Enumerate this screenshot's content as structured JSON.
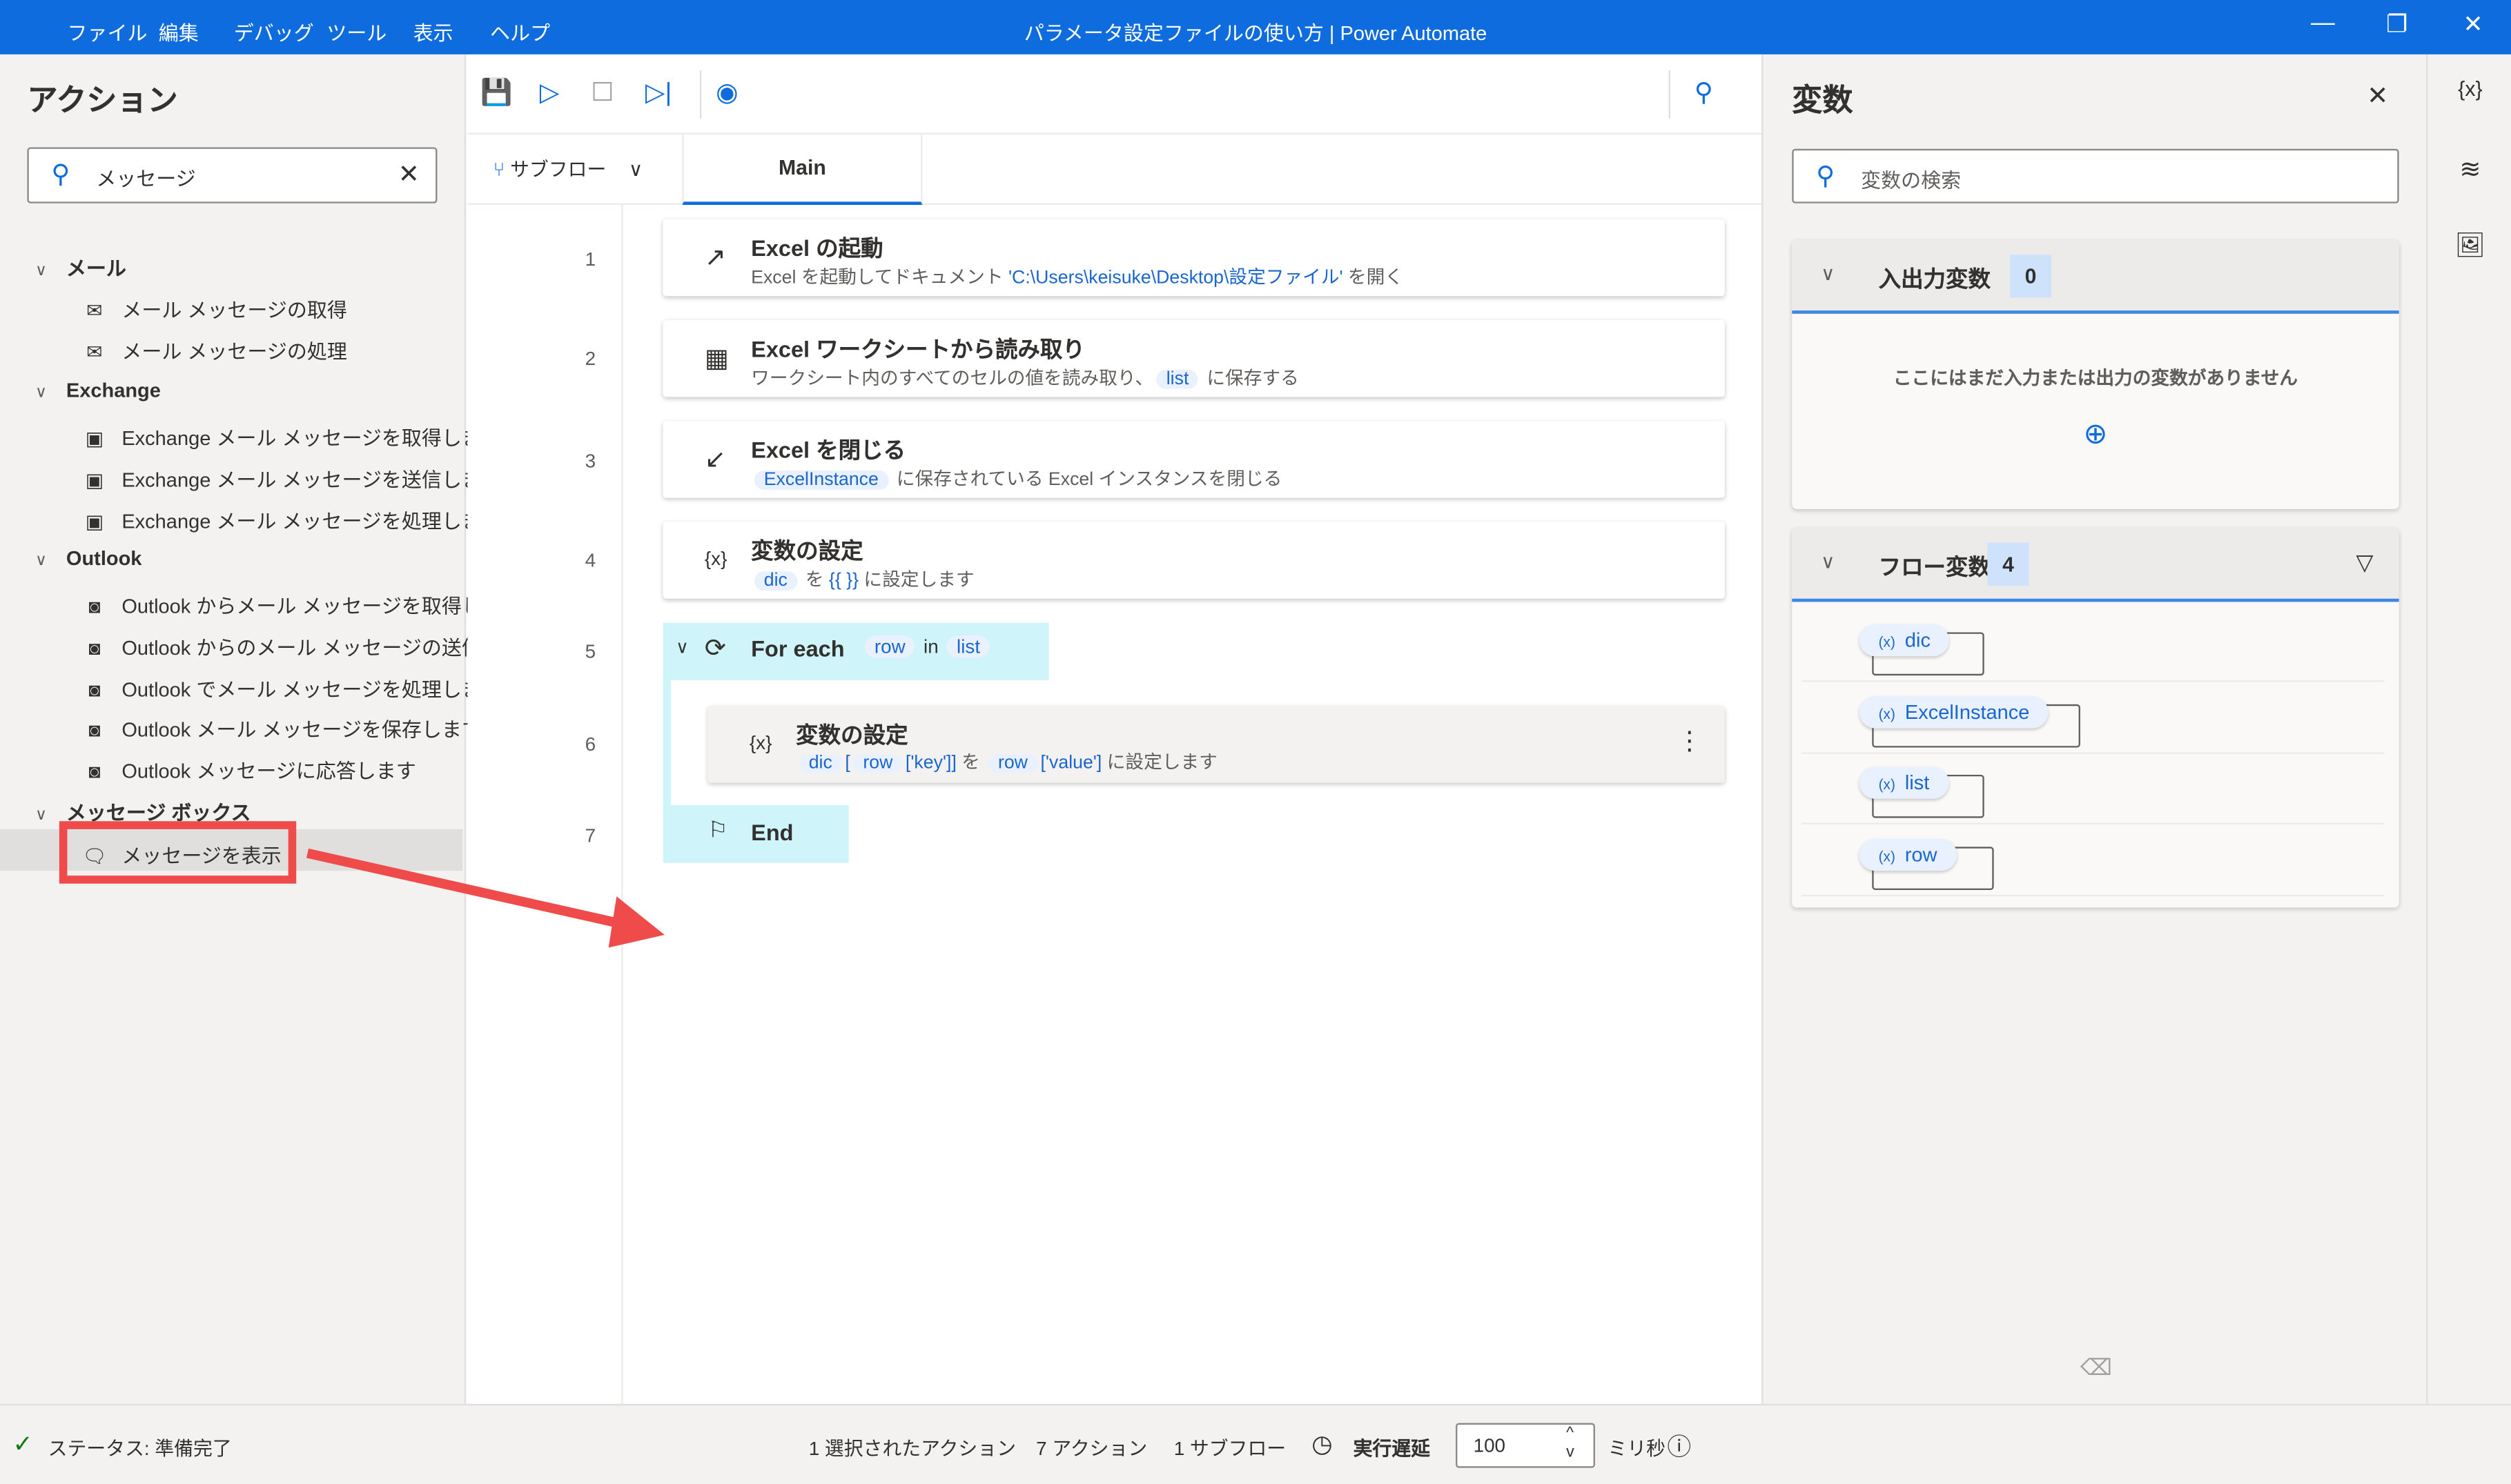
{
  "window": {
    "title": "パラメータ設定ファイルの使い方 | Power Automate",
    "menu": [
      "ファイル",
      "編集",
      "デバッグ",
      "ツール",
      "表示",
      "ヘルプ"
    ],
    "controls": [
      "—",
      "❐",
      "✕"
    ],
    "accent": "#0f6cde"
  },
  "actions_panel": {
    "title": "アクション",
    "search_value": "メッセージ",
    "groups": [
      {
        "label": "メール",
        "items": [
          "メール メッセージの取得",
          "メール メッセージの処理"
        ],
        "icon": "mail-icon"
      },
      {
        "label": "Exchange",
        "items": [
          "Exchange メール メッセージを取得します",
          "Exchange メール メッセージを送信します",
          "Exchange メール メッセージを処理します"
        ],
        "icon": "exchange-icon"
      },
      {
        "label": "Outlook",
        "items": [
          "Outlook からメール メッセージを取得し...",
          "Outlook からのメール メッセージの送信",
          "Outlook でメール メッセージを処理します",
          "Outlook メール メッセージを保存します",
          "Outlook メッセージに応答します"
        ],
        "icon": "outlook-icon"
      },
      {
        "label": "メッセージ ボックス",
        "items": [
          "メッセージを表示"
        ],
        "icon": "message-icon"
      }
    ],
    "highlight_color": "#f04b4b"
  },
  "designer": {
    "subflow_label": "サブフロー",
    "tab_main": "Main",
    "line_numbers": [
      "1",
      "2",
      "3",
      "4",
      "5",
      "6",
      "7"
    ],
    "steps": [
      {
        "title": "Excel の起動",
        "desc_pre": "Excel を起動してドキュメント ",
        "desc_link": "'C:\\Users\\keisuke\\Desktop\\設定ファイル'",
        "desc_post": " を開く"
      },
      {
        "title": "Excel ワークシートから読み取り",
        "desc_pre": "ワークシート内のすべてのセルの値を読み取り、",
        "token": "list",
        "desc_post": " に保存する"
      },
      {
        "title": "Excel を閉じる",
        "token": "ExcelInstance",
        "desc_post": " に保存されている Excel インスタンスを閉じる"
      },
      {
        "title": "変数の設定",
        "token": "dic",
        "desc_mid": " を ",
        "value": "{{ }}",
        "desc_post": " に設定します"
      },
      {
        "title": "For each",
        "token1": "row",
        "mid": "in",
        "token2": "list"
      },
      {
        "title": "変数の設定",
        "t1": "dic",
        "t2": "[",
        "t3": "row",
        "t4": "['key']]",
        "mid": " を ",
        "t5": "row",
        "t6": "['value']",
        "desc_post": " に設定します"
      },
      {
        "title": "End"
      }
    ]
  },
  "variables_panel": {
    "title": "変数",
    "search_placeholder": "変数の検索",
    "io": {
      "label": "入出力変数",
      "count": "0",
      "empty": "ここにはまだ入力または出力の変数がありません"
    },
    "flow": {
      "label": "フロー変数",
      "count": "4",
      "vars": [
        "dic",
        "ExcelInstance",
        "list",
        "row"
      ]
    }
  },
  "status": {
    "text": "ステータス: 準備完了",
    "selected": "1 選択されたアクション",
    "actions": "7 アクション",
    "subflows": "1 サブフロー",
    "delay_label": "実行遅延",
    "delay_value": "100",
    "unit": "ミリ秒"
  }
}
